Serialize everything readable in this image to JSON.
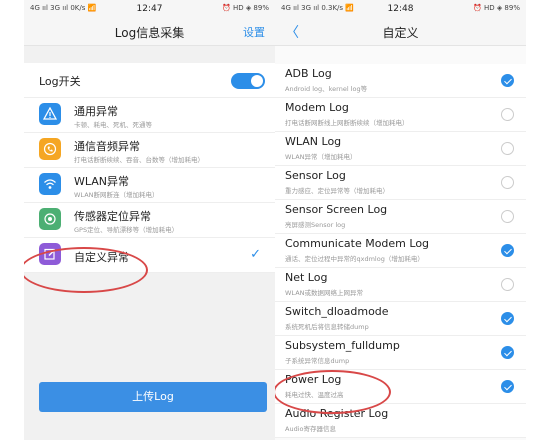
{
  "left": {
    "status": {
      "network": "4G ııl 3G ııl 0K/s 📶",
      "time": "12:47",
      "icons": "⏰ HD ◈ 89%"
    },
    "title": "Log信息采集",
    "settings": "设置",
    "switch_label": "Log开关",
    "switch_on": true,
    "items": [
      {
        "name": "通用异常",
        "desc": "卡顿、耗电、死机、死通等",
        "icon": "warning-icon",
        "color": "#2c8ee8",
        "checked": false
      },
      {
        "name": "通信音频异常",
        "desc": "打电话断断续续、吞音、台数等（增加耗电）",
        "icon": "phone-icon",
        "color": "#f5a623",
        "checked": false
      },
      {
        "name": "WLAN异常",
        "desc": "WLAN断网断连（增加耗电）",
        "icon": "wifi-icon",
        "color": "#2c8ee8",
        "checked": false
      },
      {
        "name": "传感器定位异常",
        "desc": "GPS定位、导航漂移等（增加耗电）",
        "icon": "location-icon",
        "color": "#4caf73",
        "checked": false
      },
      {
        "name": "自定义异常",
        "desc": "",
        "icon": "edit-icon",
        "color": "#8e5bd8",
        "checked": true
      }
    ],
    "check_mark": "✓",
    "upload_label": "上传Log"
  },
  "right": {
    "status": {
      "network": "4G ııl 3G ııl 0.3K/s 📶",
      "time": "12:48",
      "icons": "⏰ HD ◈ 89%"
    },
    "back": "〈",
    "title": "自定义",
    "items": [
      {
        "name": "ADB Log",
        "desc": "Android log、kernel log等",
        "checked": true
      },
      {
        "name": "Modem Log",
        "desc": "打电话断网断线上网断断续续（增加耗电）",
        "checked": false
      },
      {
        "name": "WLAN Log",
        "desc": "WLAN异常（增加耗电）",
        "checked": false
      },
      {
        "name": "Sensor Log",
        "desc": "重力感应、定位异常等（增加耗电）",
        "checked": false
      },
      {
        "name": "Sensor Screen Log",
        "desc": "亮屏感测Sensor log",
        "checked": false
      },
      {
        "name": "Communicate Modem Log",
        "desc": "通话、定位过程中异常的qxdmlog（增加耗电）",
        "checked": true
      },
      {
        "name": "Net Log",
        "desc": "WLAN或数据网络上网异常",
        "checked": false
      },
      {
        "name": "Switch_dloadmode",
        "desc": "系统死机后将信息转储dump",
        "checked": true
      },
      {
        "name": "Subsystem_fulldump",
        "desc": "子系统异常信息dump",
        "checked": true
      },
      {
        "name": "Power Log",
        "desc": "耗电过快、温度过高",
        "checked": true
      },
      {
        "name": "Audio Register Log",
        "desc": "Audio寄存器信息",
        "checked": false
      }
    ]
  },
  "accent": "#2c8ee8"
}
